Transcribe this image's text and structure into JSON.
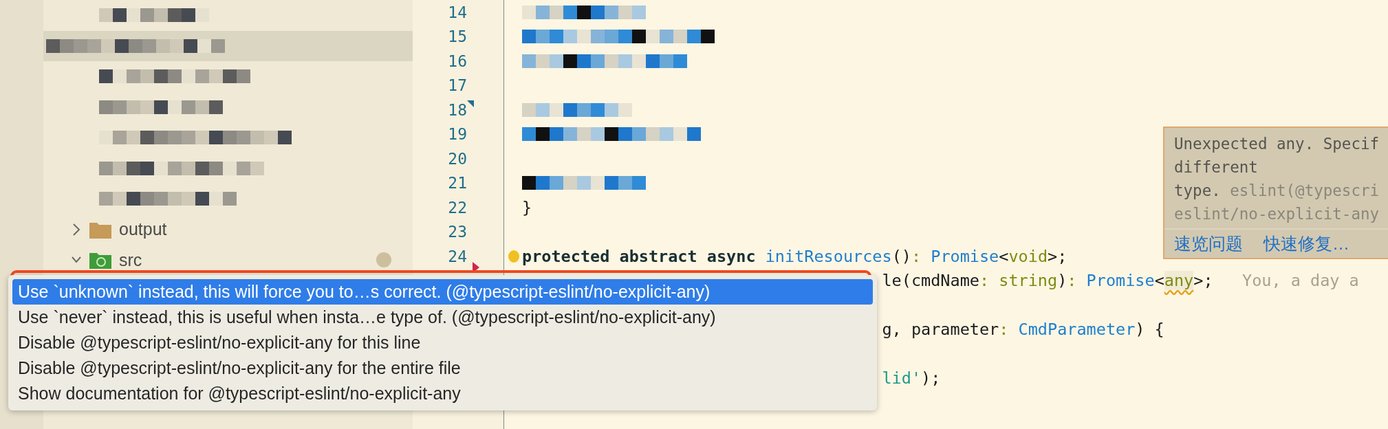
{
  "tree": [
    {
      "kind": "redacted",
      "selected": false
    },
    {
      "kind": "redacted",
      "selected": true
    },
    {
      "kind": "redacted",
      "selected": false
    },
    {
      "kind": "redacted",
      "selected": false
    },
    {
      "kind": "redacted",
      "selected": false
    },
    {
      "kind": "redacted",
      "selected": false
    },
    {
      "kind": "redacted",
      "selected": false
    },
    {
      "kind": "folder",
      "label": "output",
      "expanded": false,
      "selected": false
    },
    {
      "kind": "source-folder",
      "label": "src",
      "expanded": true,
      "selected": false
    }
  ],
  "editor": {
    "lines": [
      {
        "kind": "redacted",
        "number": "14"
      },
      {
        "kind": "redacted",
        "number": "15"
      },
      {
        "kind": "redacted",
        "number": "16"
      },
      {
        "kind": "blank",
        "number": "17"
      },
      {
        "kind": "redacted",
        "number": "18",
        "bookmark": true
      },
      {
        "kind": "redacted",
        "number": "19"
      },
      {
        "kind": "blank",
        "number": "20"
      },
      {
        "kind": "redacted",
        "number": "21"
      },
      {
        "kind": "code",
        "number": "22",
        "segments": [
          {
            "text": "}",
            "kind": "plain"
          }
        ]
      },
      {
        "kind": "blank",
        "number": "23"
      },
      {
        "kind": "code",
        "number": "24",
        "error": true,
        "bulb": true,
        "segments": [
          {
            "text": "protected abstract async",
            "kind": "keyword"
          },
          {
            "text": " initResources",
            "kind": "func"
          },
          {
            "text": "()",
            "kind": "plain"
          },
          {
            "text": ": ",
            "kind": "punct"
          },
          {
            "text": "Promise",
            "kind": "type"
          },
          {
            "text": "<",
            "kind": "plain"
          },
          {
            "text": "void",
            "kind": "punct"
          },
          {
            "text": ">;",
            "kind": "plain"
          }
        ]
      },
      {
        "kind": "fragment",
        "blame": "You, a day a",
        "segments": [
          {
            "text": "le(cmdName",
            "kind": "plain"
          },
          {
            "text": ": string",
            "kind": "punct"
          },
          {
            "text": ")",
            "kind": "plain"
          },
          {
            "text": ": ",
            "kind": "punct"
          },
          {
            "text": "Promise",
            "kind": "type"
          },
          {
            "text": "<",
            "kind": "plain"
          },
          {
            "text": "any",
            "kind": "warning"
          },
          {
            "text": ">;",
            "kind": "plain"
          }
        ]
      },
      {
        "kind": "blank"
      },
      {
        "kind": "fragment",
        "segments": [
          {
            "text": "g, parameter",
            "kind": "plain"
          },
          {
            "text": ": ",
            "kind": "punct"
          },
          {
            "text": "CmdParameter",
            "kind": "type"
          },
          {
            "text": ") {",
            "kind": "plain"
          }
        ]
      },
      {
        "kind": "blank"
      },
      {
        "kind": "fragment",
        "segments": [
          {
            "text": "lid'",
            "kind": "string"
          },
          {
            "text": ");",
            "kind": "plain"
          }
        ]
      },
      {
        "kind": "blank"
      },
      {
        "kind": "blank"
      }
    ]
  },
  "tooltip": {
    "lines": [
      {
        "segments": [
          {
            "text": "Unexpected any. Specif",
            "kind": "message"
          }
        ]
      },
      {
        "segments": [
          {
            "text": "different",
            "kind": "message"
          }
        ]
      },
      {
        "segments": [
          {
            "text": "type.",
            "kind": "message"
          },
          {
            "text": " eslint(@typescri",
            "kind": "source"
          }
        ]
      },
      {
        "segments": [
          {
            "text": "eslint/no-explicit-any",
            "kind": "source"
          }
        ]
      }
    ],
    "links": [
      "速览问题",
      "快速修复…"
    ]
  },
  "menu": {
    "items": [
      {
        "text": "Use `unknown` instead, this will force you to…s correct. (@typescript-eslint/no-explicit-any)",
        "selected": true
      },
      {
        "text": "Use `never` instead, this is useful when insta…e type of. (@typescript-eslint/no-explicit-any)",
        "selected": false
      },
      {
        "text": "Disable @typescript-eslint/no-explicit-any for this line",
        "selected": false
      },
      {
        "text": "Disable @typescript-eslint/no-explicit-any for the entire file",
        "selected": false
      },
      {
        "text": "Show documentation for @typescript-eslint/no-explicit-any",
        "selected": false
      }
    ]
  }
}
